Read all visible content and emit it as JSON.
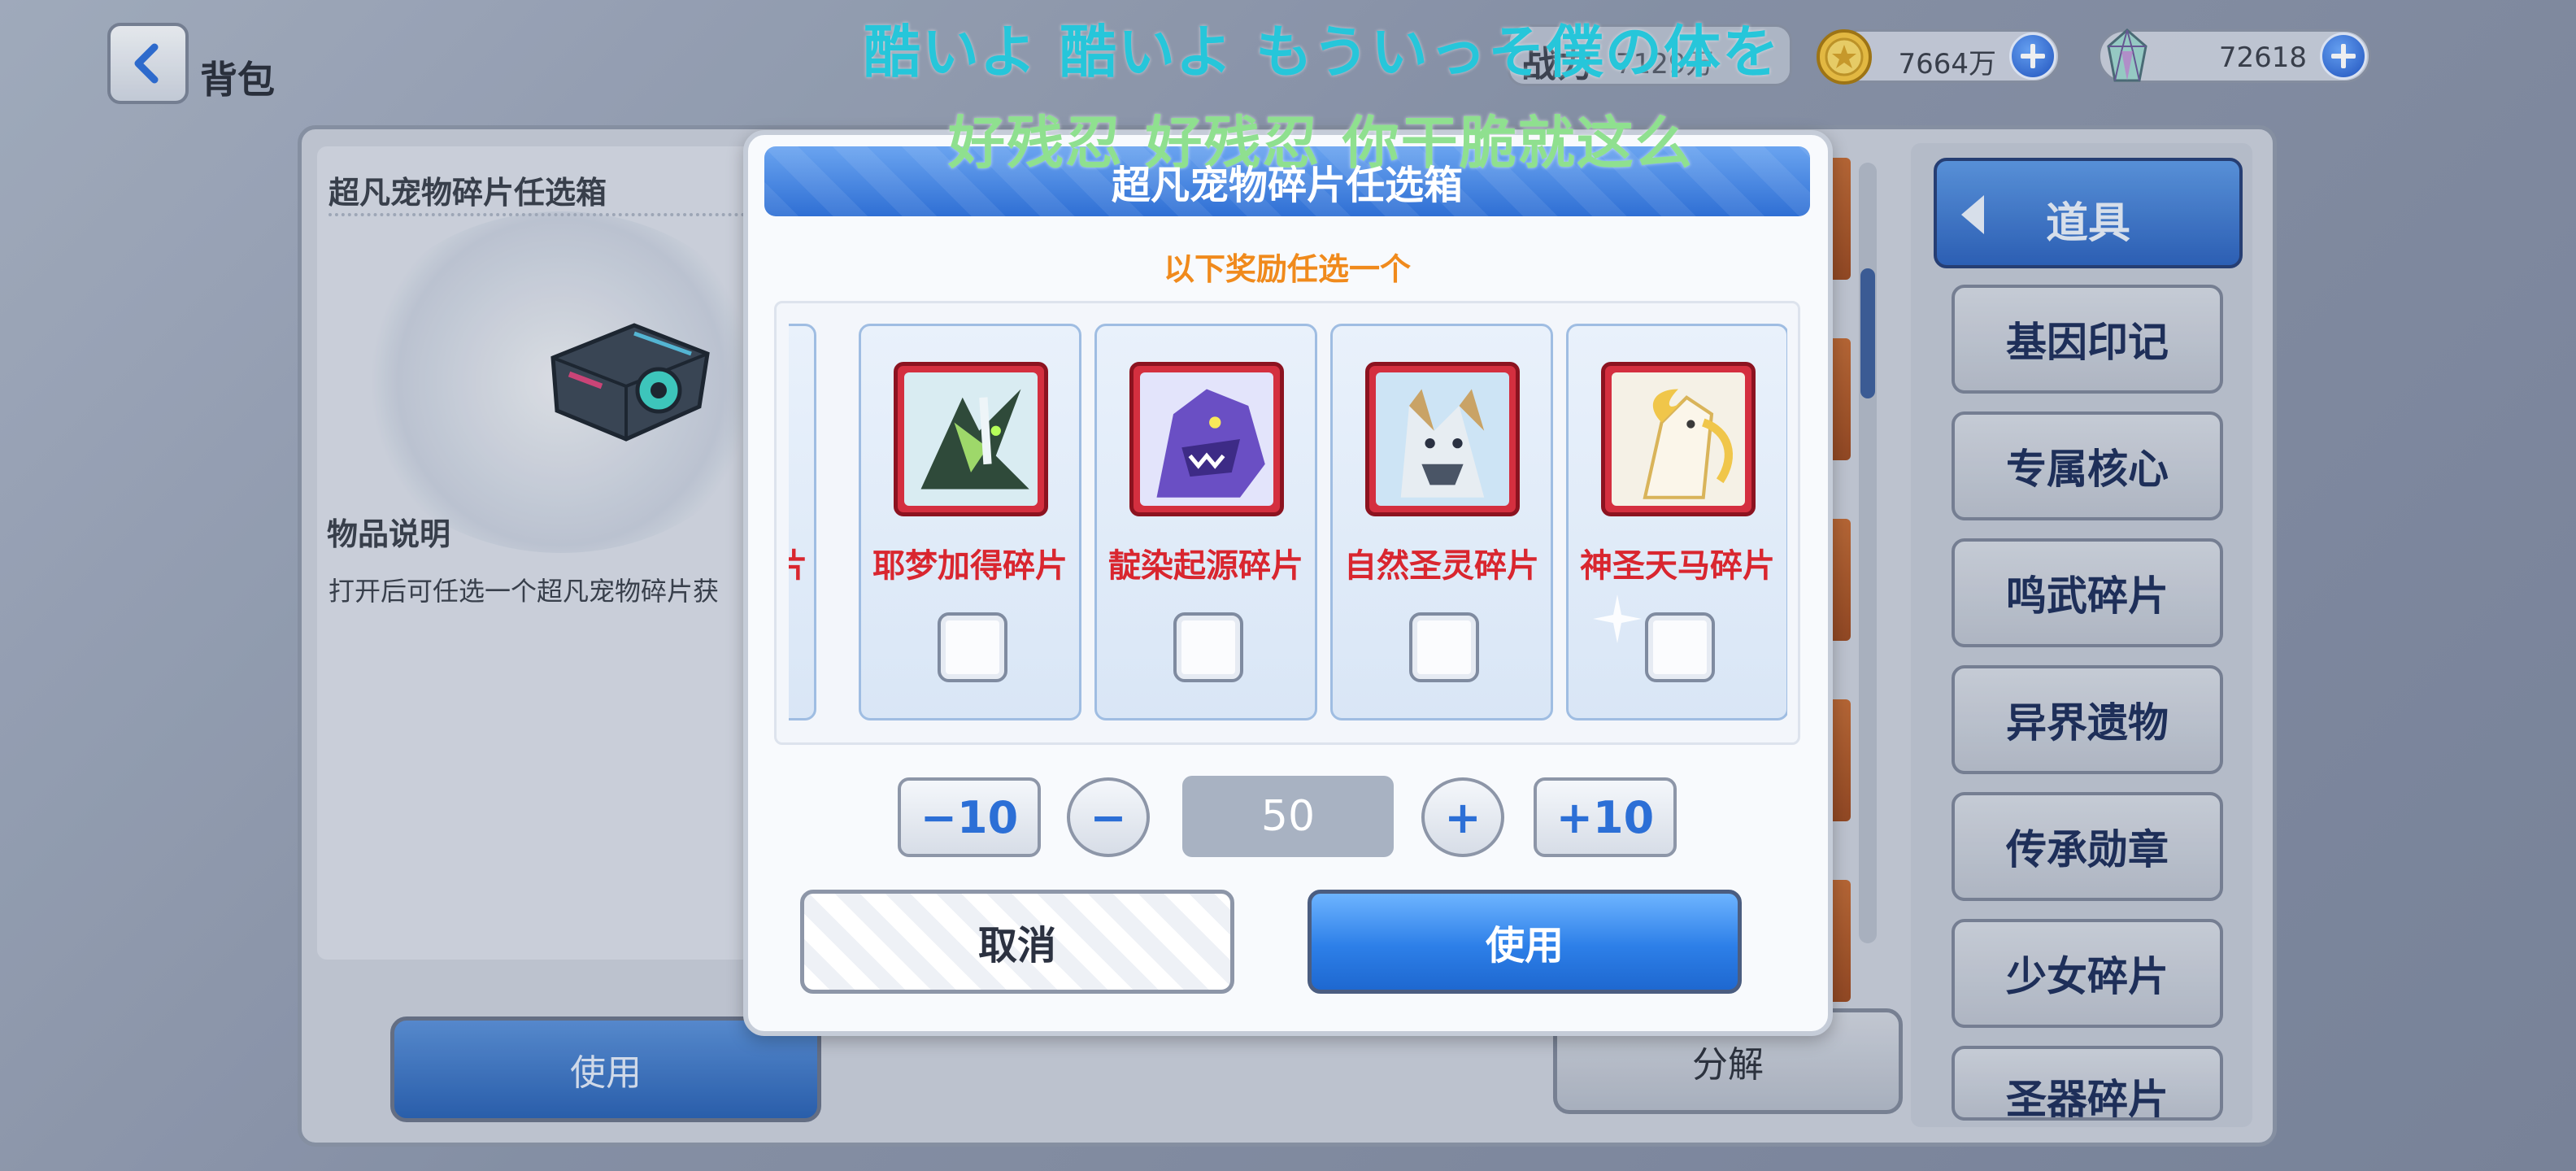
{
  "topbar": {
    "back_label": "背包",
    "power_label": "战力",
    "power_value": "7129万",
    "gold_value": "7664万",
    "gem_value": "72618"
  },
  "left_panel": {
    "item_title": "超凡宠物碎片任选箱",
    "desc_title": "物品说明",
    "desc_text": "打开后可任选一个超凡宠物碎片获",
    "use_label": "使用",
    "decompose_label": "分解"
  },
  "categories": {
    "header": "道具",
    "items": [
      "基因印记",
      "专属核心",
      "鸣武碎片",
      "异界遗物",
      "传承勋章",
      "少女碎片",
      "圣器碎片"
    ]
  },
  "modal": {
    "title": "超凡宠物碎片任选箱",
    "subtitle": "以下奖励任选一个",
    "rewards": [
      {
        "name": "…碎片",
        "checked": false
      },
      {
        "name": "耶梦加得碎片",
        "checked": false
      },
      {
        "name": "靛染起源碎片",
        "checked": false
      },
      {
        "name": "自然圣灵碎片",
        "checked": false
      },
      {
        "name": "神圣天马碎片",
        "checked": false
      }
    ],
    "minus10": "−10",
    "minus": "−",
    "quantity": "50",
    "plus": "+",
    "plus10": "+10",
    "cancel_label": "取消",
    "use_label": "使用"
  },
  "lyrics": {
    "line1": "酷いよ 酷いよ もういっそ僕の体を",
    "line2": "好残忍 好残忍 你干脆就这么"
  },
  "colors": {
    "accent_blue": "#2f6fd4",
    "reward_name_red": "#d9262f",
    "subtitle_orange": "#f08a1c"
  }
}
